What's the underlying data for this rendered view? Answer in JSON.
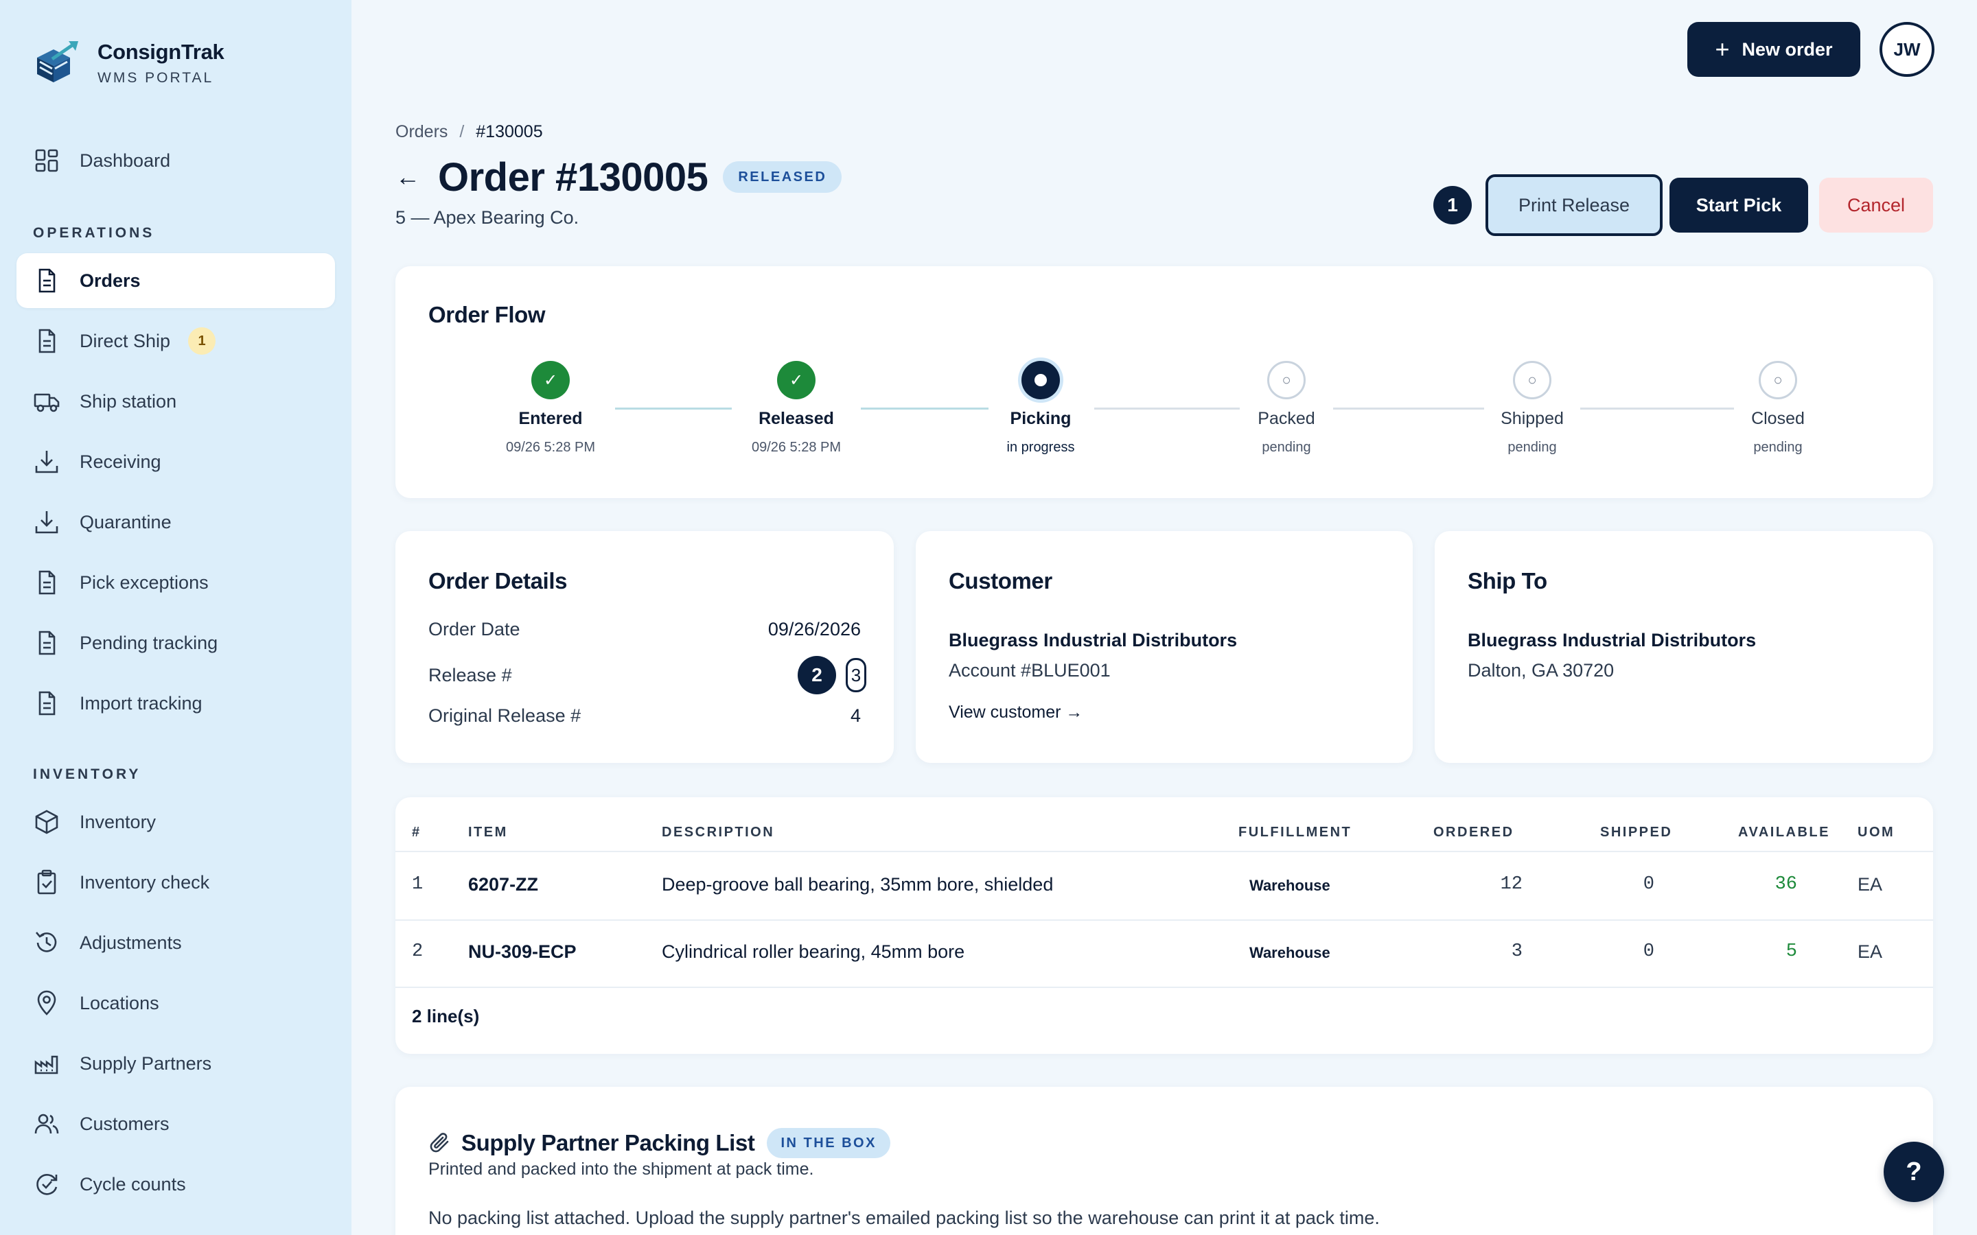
{
  "brand": {
    "name": "ConsignTrak",
    "subtitle": "WMS PORTAL"
  },
  "sidebar": {
    "items": [
      {
        "label": "Dashboard",
        "icon": "grid-icon"
      },
      {
        "label": "Orders",
        "icon": "document-icon",
        "active": true
      },
      {
        "label": "Direct Ship",
        "icon": "document-icon",
        "badge": "1"
      },
      {
        "label": "Ship station",
        "icon": "truck-icon"
      },
      {
        "label": "Receiving",
        "icon": "download-icon"
      },
      {
        "label": "Quarantine",
        "icon": "download-icon"
      },
      {
        "label": "Pick exceptions",
        "icon": "document-icon"
      },
      {
        "label": "Pending tracking",
        "icon": "document-icon"
      },
      {
        "label": "Import tracking",
        "icon": "document-icon"
      },
      {
        "label": "Inventory",
        "icon": "box-icon"
      },
      {
        "label": "Inventory check",
        "icon": "clipboard-check-icon"
      },
      {
        "label": "Adjustments",
        "icon": "history-icon"
      },
      {
        "label": "Locations",
        "icon": "map-pin-icon"
      },
      {
        "label": "Supply Partners",
        "icon": "factory-icon"
      },
      {
        "label": "Customers",
        "icon": "users-icon"
      },
      {
        "label": "Cycle counts",
        "icon": "refresh-check-icon"
      }
    ],
    "sections": {
      "operations": "OPERATIONS",
      "inventory": "INVENTORY"
    }
  },
  "topbar": {
    "new_order_label": "New order",
    "avatar_initials": "JW"
  },
  "header": {
    "breadcrumb": {
      "parent": "Orders",
      "separator": "/",
      "current": "#130005"
    },
    "back_arrow": "←",
    "title": "Order #130005",
    "status": "RELEASED",
    "subtitle": "5 — Apex Bearing Co."
  },
  "actions": {
    "marker": "1",
    "print_release": "Print Release",
    "start_pick": "Start Pick",
    "cancel": "Cancel"
  },
  "order_flow": {
    "title": "Order Flow",
    "steps": [
      {
        "label": "Entered",
        "sub": "09/26 5:28 PM",
        "state": "done"
      },
      {
        "label": "Released",
        "sub": "09/26 5:28 PM",
        "state": "done"
      },
      {
        "label": "Picking",
        "sub": "in progress",
        "state": "current"
      },
      {
        "label": "Packed",
        "sub": "pending",
        "state": "pending"
      },
      {
        "label": "Shipped",
        "sub": "pending",
        "state": "pending"
      },
      {
        "label": "Closed",
        "sub": "pending",
        "state": "pending"
      }
    ],
    "done_glyph": "✓",
    "pending_glyph": "○"
  },
  "order_details": {
    "title": "Order Details",
    "order_date_label": "Order Date",
    "order_date": "09/26/2026",
    "release_label": "Release #",
    "release_marker": "2",
    "release_value": "3",
    "original_release_label": "Original Release #",
    "original_release": "4"
  },
  "customer": {
    "title": "Customer",
    "name": "Bluegrass Industrial Distributors",
    "account": "Account #BLUE001",
    "link": "View customer →"
  },
  "ship_to": {
    "title": "Ship To",
    "name": "Bluegrass Industrial Distributors",
    "address": "Dalton, GA 30720"
  },
  "lines": {
    "headers": [
      "#",
      "ITEM",
      "DESCRIPTION",
      "FULFILLMENT",
      "ORDERED",
      "SHIPPED",
      "AVAILABLE",
      "UOM"
    ],
    "rows": [
      {
        "n": "1",
        "item": "6207-ZZ",
        "desc": "Deep-groove ball bearing, 35mm bore, shielded",
        "fulfillment": "Warehouse",
        "ordered": "12",
        "shipped": "0",
        "available": "36",
        "uom": "EA"
      },
      {
        "n": "2",
        "item": "NU-309-ECP",
        "desc": "Cylindrical roller bearing, 45mm bore",
        "fulfillment": "Warehouse",
        "ordered": "3",
        "shipped": "0",
        "available": "5",
        "uom": "EA"
      }
    ],
    "footer": "2 line(s)"
  },
  "packing": {
    "title": "Supply Partner Packing List",
    "pill": "IN THE BOX",
    "subtitle": "Printed and packed into the shipment at pack time.",
    "note": "No packing list attached. Upload the supply partner's emailed packing list so the warehouse can print it at pack time."
  },
  "help": {
    "label": "?"
  },
  "colors": {
    "navy": "#0b1f3d",
    "success": "#1d8a3a",
    "danger": "#b3262d",
    "sidebar_bg": "#dceefa",
    "page_bg": "#f1f7fc",
    "pill_bg": "#cfe6f7"
  }
}
